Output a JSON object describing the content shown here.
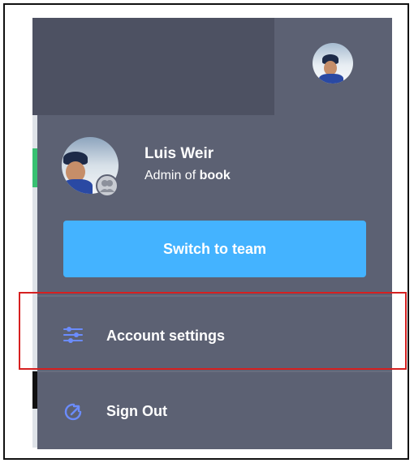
{
  "user": {
    "name": "Luis Weir",
    "role_prefix": "Admin of ",
    "org": "book"
  },
  "actions": {
    "switch_label": "Switch to team"
  },
  "menu": [
    {
      "label": "Account settings",
      "icon": "sliders-icon"
    },
    {
      "label": "Sign Out",
      "icon": "sign-out-icon"
    }
  ],
  "colors": {
    "panel": "#5c6173",
    "panel_top": "#4d5162",
    "button": "#44b3ff",
    "icon_accent": "#6b8cff",
    "highlight": "#d62020"
  }
}
